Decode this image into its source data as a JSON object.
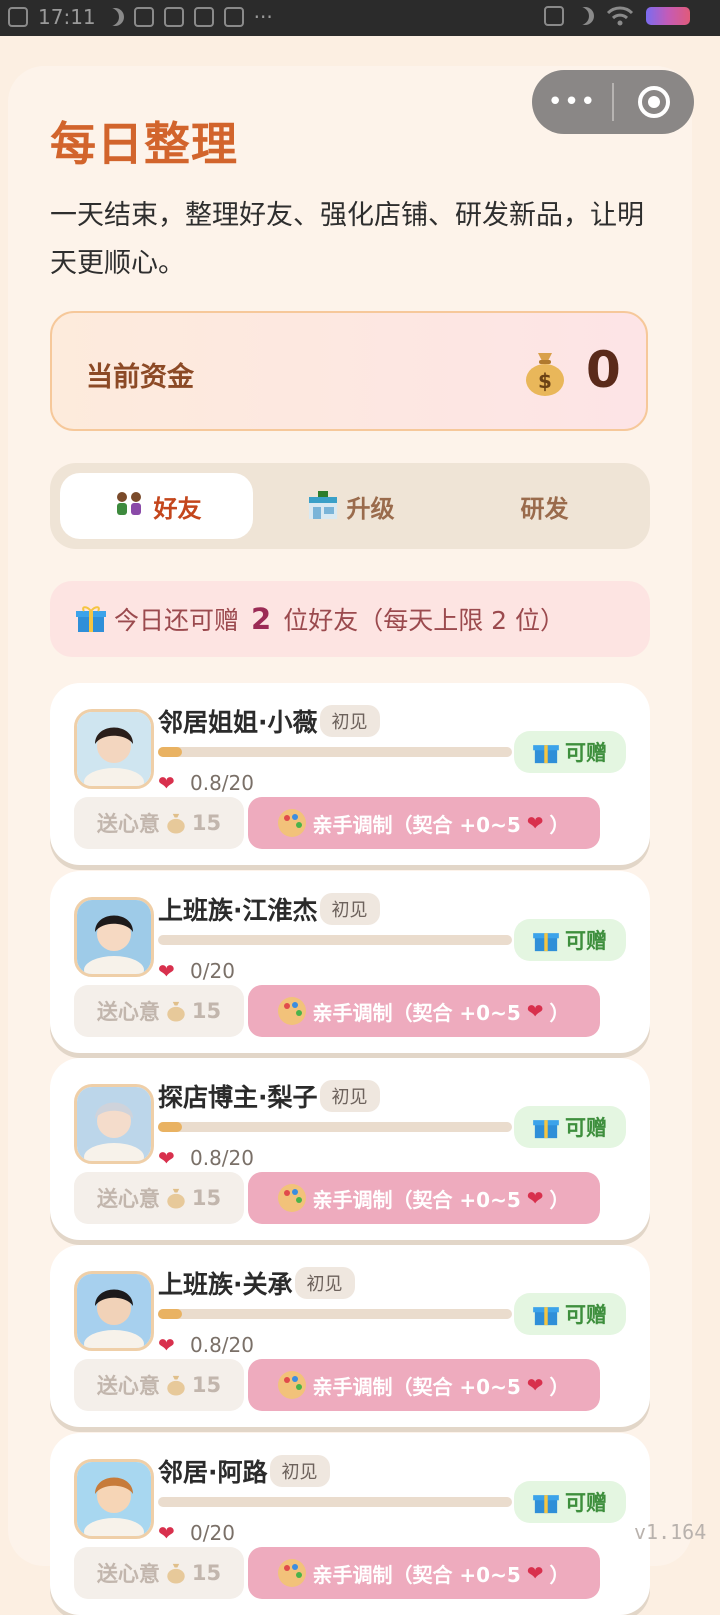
{
  "status_bar": {
    "time": "17:11"
  },
  "header": {
    "title": "每日整理",
    "subtitle": "一天结束，整理好友、强化店铺、研发新品，让明天更顺心。"
  },
  "funds": {
    "label": "当前资金",
    "value": "0"
  },
  "tabs": [
    {
      "label": "好友",
      "active": true
    },
    {
      "label": "升级",
      "active": false
    },
    {
      "label": "研发",
      "active": false
    }
  ],
  "notice": {
    "prefix": "今日还可赠",
    "count": "2",
    "suffix": "位好友（每天上限 2 位）"
  },
  "friends": [
    {
      "name": "邻居姐姐·小薇",
      "tag": "初见",
      "score": "0.8/20",
      "progress": 0.04,
      "status": "可赠",
      "gift_label": "送心意",
      "gift_cost": "15",
      "craft_label": "亲手调制（契合 +0~5",
      "craft_end": "）"
    },
    {
      "name": "上班族·江淮杰",
      "tag": "初见",
      "score": "0/20",
      "progress": 0,
      "status": "可赠",
      "gift_label": "送心意",
      "gift_cost": "15",
      "craft_label": "亲手调制（契合 +0~5",
      "craft_end": "）"
    },
    {
      "name": "探店博主·梨子",
      "tag": "初见",
      "score": "0.8/20",
      "progress": 0.04,
      "status": "可赠",
      "gift_label": "送心意",
      "gift_cost": "15",
      "craft_label": "亲手调制（契合 +0~5",
      "craft_end": "）"
    },
    {
      "name": "上班族·关承",
      "tag": "初见",
      "score": "0.8/20",
      "progress": 0.04,
      "status": "可赠",
      "gift_label": "送心意",
      "gift_cost": "15",
      "craft_label": "亲手调制（契合 +0~5",
      "craft_end": "）"
    },
    {
      "name": "邻居·阿路",
      "tag": "初见",
      "score": "0/20",
      "progress": 0,
      "status": "可赠",
      "gift_label": "送心意",
      "gift_cost": "15",
      "craft_label": "亲手调制（契合 +0~5",
      "craft_end": "）"
    }
  ],
  "version": "v1.164"
}
